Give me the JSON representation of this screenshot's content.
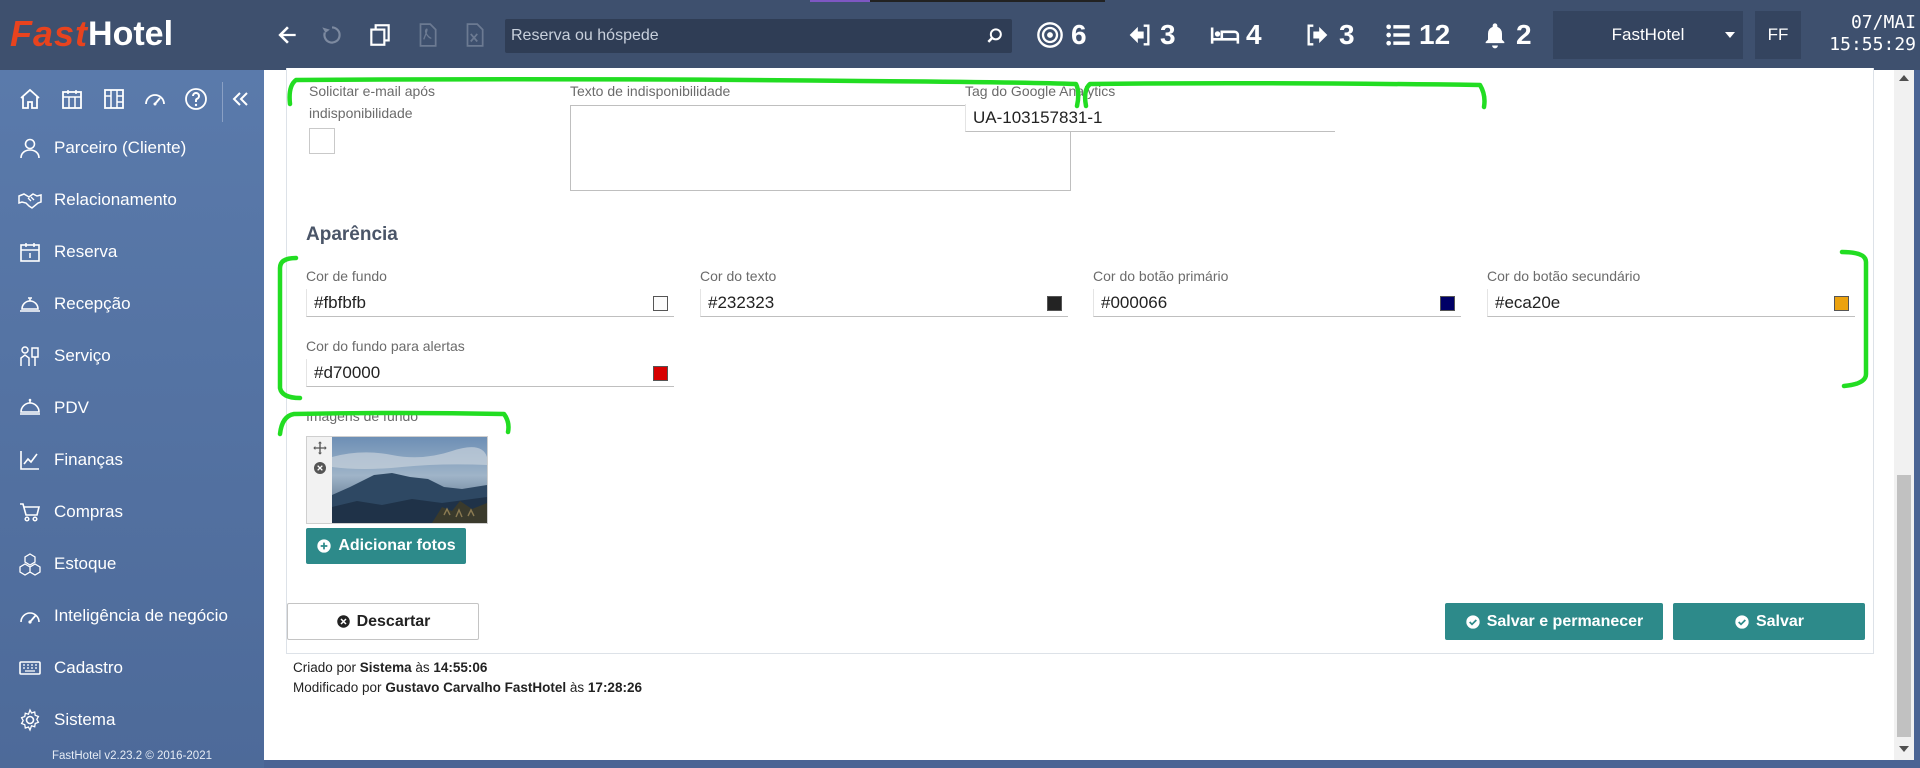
{
  "app": {
    "logo_fast": "Fast",
    "logo_hotel": "Hotel",
    "version": "FastHotel v2.23.2 © 2016-2021"
  },
  "topbar": {
    "search_placeholder": "Reserva ou hóspede",
    "counters": {
      "targets": "6",
      "arrivals": "3",
      "in_house": "4",
      "departures": "3",
      "tasks": "12",
      "notifications": "2"
    },
    "hotel": "FastHotel",
    "user_initials": "FF",
    "date": "07/MAI",
    "time": "15:55:29"
  },
  "sidebar": {
    "items": [
      {
        "label": "Parceiro (Cliente)",
        "icon": "person-icon"
      },
      {
        "label": "Relacionamento",
        "icon": "handshake-icon"
      },
      {
        "label": "Reserva",
        "icon": "calendar-icon"
      },
      {
        "label": "Recepção",
        "icon": "reception-bell-icon"
      },
      {
        "label": "Serviço",
        "icon": "service-icon"
      },
      {
        "label": "PDV",
        "icon": "cloche-icon"
      },
      {
        "label": "Finanças",
        "icon": "line-chart-icon"
      },
      {
        "label": "Compras",
        "icon": "cart-icon"
      },
      {
        "label": "Estoque",
        "icon": "boxes-icon"
      },
      {
        "label": "Inteligência de negócio",
        "icon": "gauge-icon"
      },
      {
        "label": "Cadastro",
        "icon": "keyboard-icon"
      },
      {
        "label": "Sistema",
        "icon": "gear-icon"
      }
    ]
  },
  "form": {
    "email_label": "Solicitar e-mail após indisponibilidade",
    "unavailable_text_label": "Texto de indisponibilidade",
    "unavailable_text_value": "",
    "analytics_label": "Tag do Google Analytics",
    "analytics_value": "UA-103157831-1",
    "appearance_title": "Aparência",
    "colors": [
      {
        "label": "Cor de fundo",
        "value": "#fbfbfb",
        "swatch": "#fbfbfb"
      },
      {
        "label": "Cor do texto",
        "value": "#232323",
        "swatch": "#232323"
      },
      {
        "label": "Cor do botão primário",
        "value": "#000066",
        "swatch": "#000066"
      },
      {
        "label": "Cor do botão secundário",
        "value": "#eca20e",
        "swatch": "#eca20e"
      },
      {
        "label": "Cor do fundo para alertas",
        "value": "#d70000",
        "swatch": "#d70000"
      }
    ],
    "background_images_label": "Imagens de fundo",
    "add_photos_label": "Adicionar fotos"
  },
  "actions": {
    "discard_label": "Descartar",
    "save_stay_label": "Salvar e permanecer",
    "save_label": "Salvar"
  },
  "meta": {
    "created_prefix": "Criado por",
    "created_by": "Sistema",
    "created_at_prefix": "às",
    "created_at": "14:55:06",
    "modified_prefix": "Modificado por",
    "modified_by": "Gustavo Carvalho FastHotel",
    "modified_at_prefix": "às",
    "modified_at": "17:28:26"
  },
  "theme": {
    "topbar": "#3e506e",
    "sidebar": "#5a7aab",
    "teal": "#2d8a8a",
    "annotation_green": "#22dd22"
  }
}
